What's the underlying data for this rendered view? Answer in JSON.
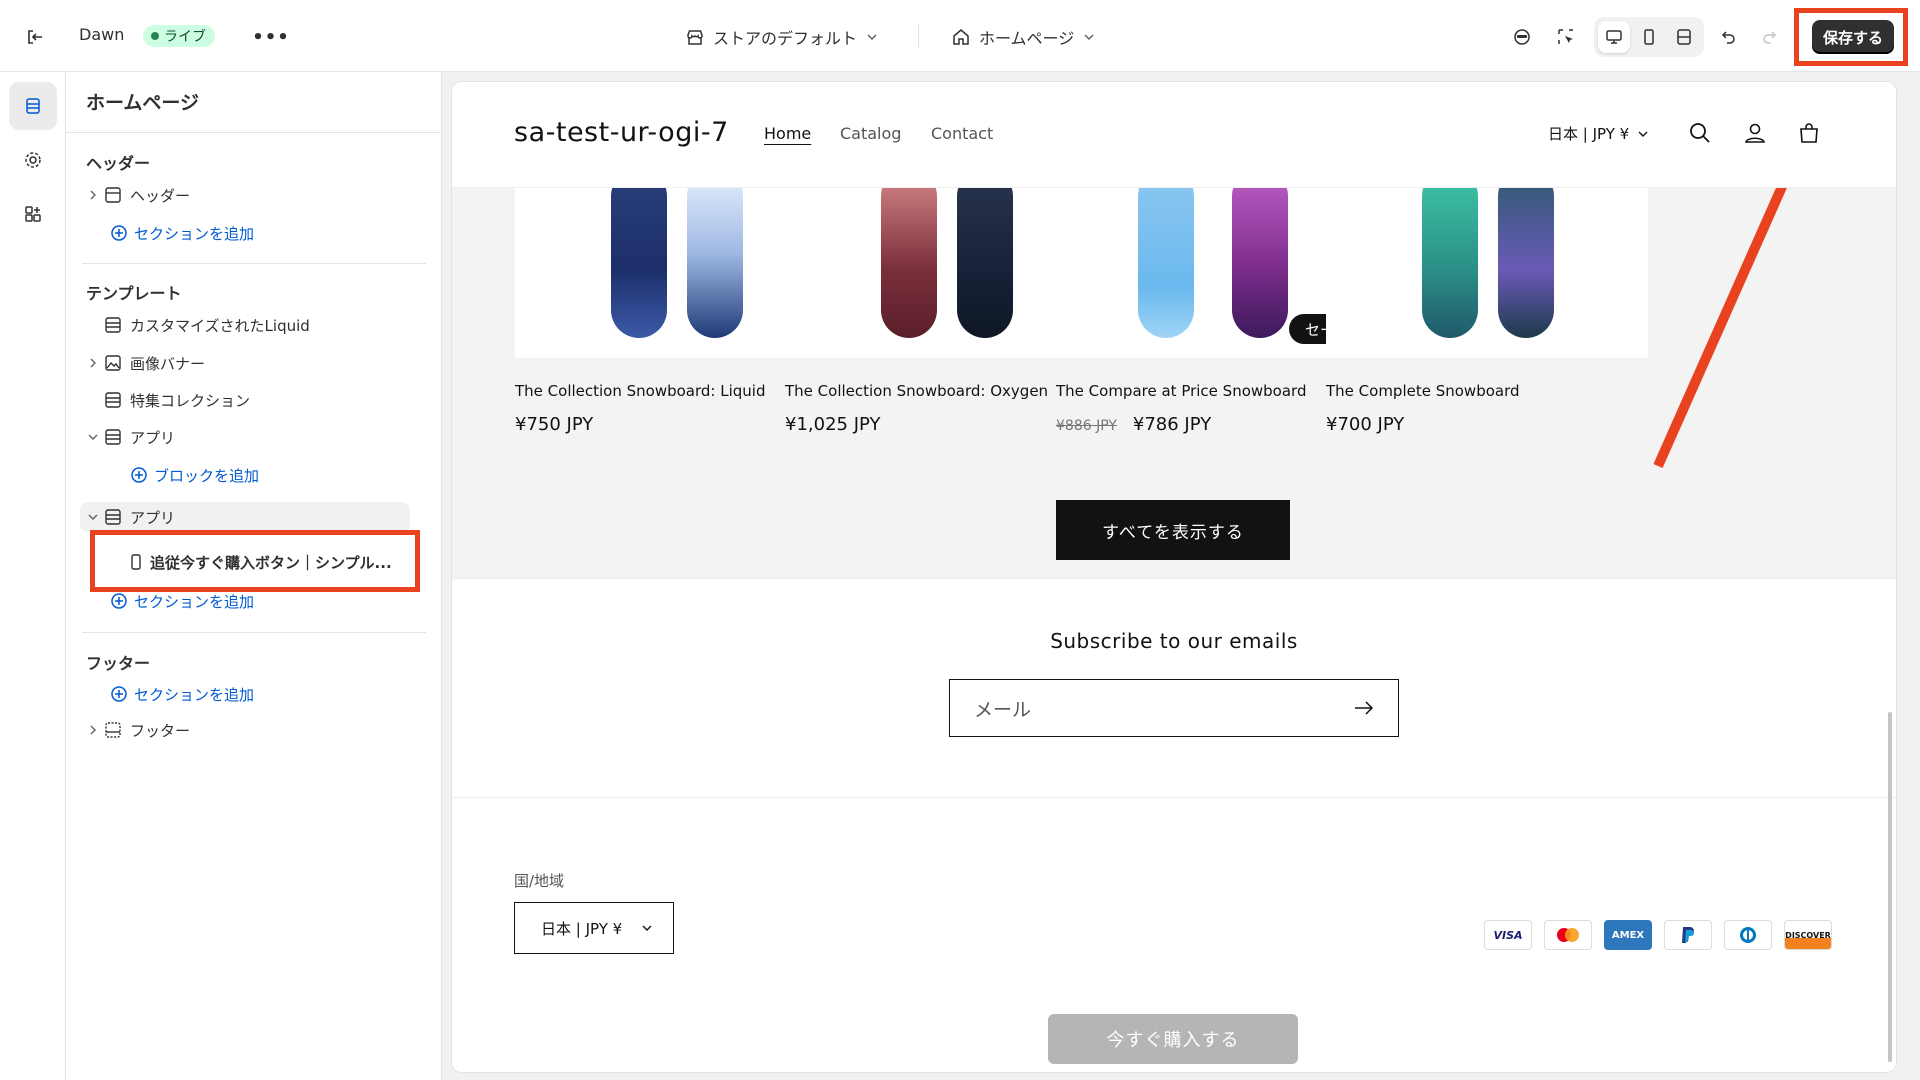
{
  "topbar": {
    "theme_name": "Dawn",
    "live_label": "ライブ",
    "more_label": "•••",
    "store_selector": "ストアのデフォルト",
    "page_selector": "ホームページ",
    "save_label": "保存する"
  },
  "panel": {
    "title": "ホームページ",
    "header_group": "ヘッダー",
    "header_item": "ヘッダー",
    "add_section": "セクションを追加",
    "template_group": "テンプレート",
    "template_items": [
      "カスタマイズされたLiquid",
      "画像バナー",
      "特集コレクション",
      "アプリ",
      "アプリ"
    ],
    "add_block": "ブロックを追加",
    "app_block": "追従今すぐ購入ボタン｜シンプル...",
    "footer_group": "フッター",
    "footer_item": "フッター"
  },
  "store": {
    "logo": "sa-test-ur-ogi-7",
    "nav": [
      "Home",
      "Catalog",
      "Contact"
    ],
    "locale": "日本 | JPY ¥",
    "products": [
      {
        "title": "The Collection Snowboard: Liquid",
        "price": "¥750 JPY"
      },
      {
        "title": "The Collection Snowboard: Oxygen",
        "price": "¥1,025 JPY"
      },
      {
        "title": "The Compare at Price Snowboard",
        "old_price": "¥886 JPY",
        "price": "¥786 JPY",
        "badge": "セール"
      },
      {
        "title": "The Complete Snowboard",
        "price": "¥700 JPY"
      }
    ],
    "view_all": "すべてを表示する",
    "subscribe_title": "Subscribe to our emails",
    "email_placeholder": "メール",
    "country_label": "国/地域",
    "country_value": "日本 | JPY ¥",
    "payments": [
      "VISA",
      "Mastercard",
      "AMEX",
      "PayPal",
      "Diners",
      "DISCOVER"
    ],
    "buy_now": "今すぐ購入する"
  },
  "colors": {
    "highlight": "#e8421f",
    "link": "#005bd3",
    "live_bg": "#cdfee1"
  }
}
